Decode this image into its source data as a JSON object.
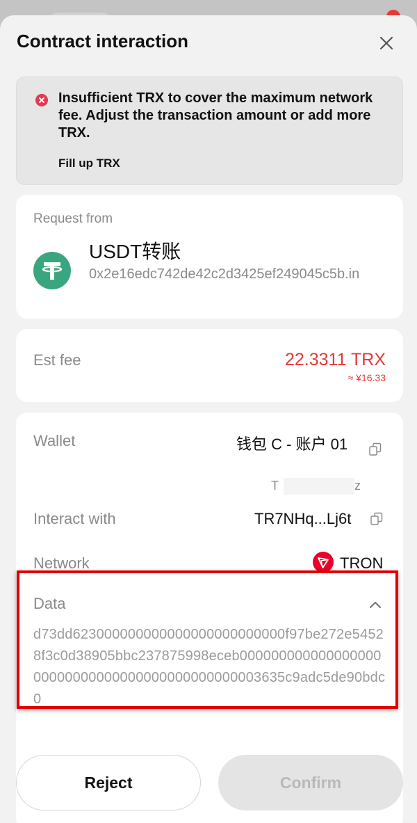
{
  "header": {
    "title": "Contract interaction",
    "close_icon": "close-icon"
  },
  "alert": {
    "message": "Insufficient TRX to cover the maximum network fee. Adjust the transaction amount or add more TRX.",
    "action_label": "Fill up TRX",
    "icon": "error-icon",
    "color": "#e53950"
  },
  "request": {
    "label": "Request from",
    "app_name": "USDT转账",
    "app_url": "0x2e16edc742de42c2d3425ef249045c5b.in",
    "icon": "tether-icon",
    "icon_color": "#3aa67f"
  },
  "fee": {
    "label": "Est fee",
    "amount": "22.3311 TRX",
    "fiat": "≈ ¥16.33",
    "color": "#e53935"
  },
  "details": {
    "wallet_label": "Wallet",
    "wallet_name": "钱包 C - 账户 01",
    "wallet_address_start": "T",
    "wallet_address_end": "z",
    "interact_label": "Interact with",
    "contract_address": "TR7NHq...Lj6t",
    "network_label": "Network",
    "network_name": "TRON",
    "network_icon_color": "#eb0029",
    "data_label": "Data",
    "data_hex": "d73dd623000000000000000000000000f97be272e54528f3c0d38905bbc237875998eceb00000000000000000000000000000000000000000000003635c9adc5de90bdc0"
  },
  "actions": {
    "reject_label": "Reject",
    "confirm_label": "Confirm"
  },
  "annotation": {
    "highlight_color": "#e10000"
  }
}
